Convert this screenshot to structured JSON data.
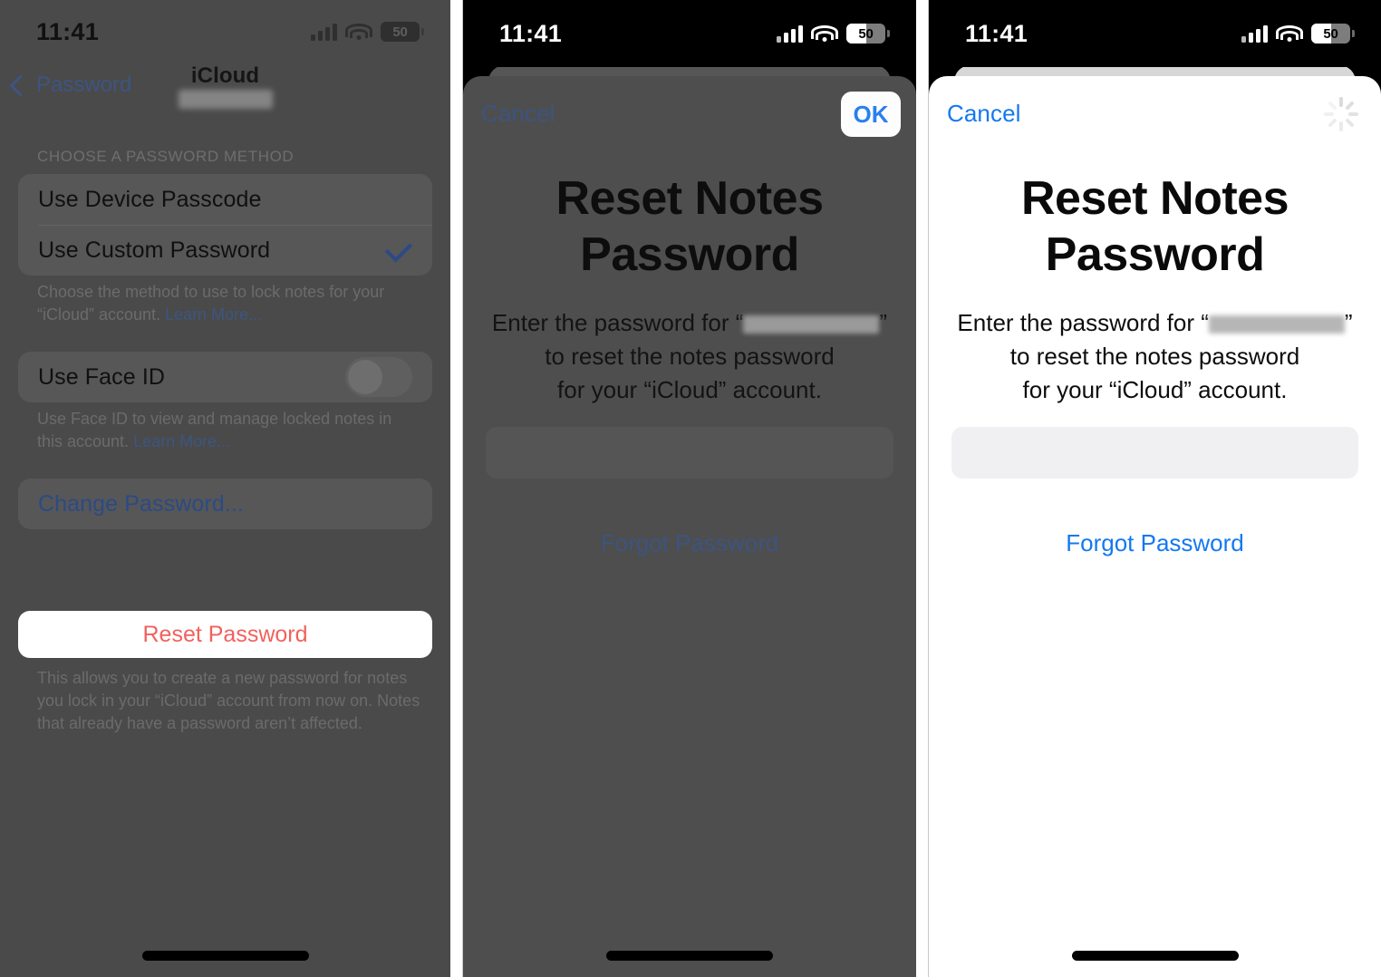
{
  "colors": {
    "ios_blue": "#1478f0",
    "destructive_red": "#f2615c",
    "dim_background": "#4a4a4a",
    "sheet_white": "#ffffff",
    "status_dark": "#000000"
  },
  "status_bar": {
    "time": "11:41",
    "battery_percent": "50",
    "icons": [
      "cellular-signal-icon",
      "wifi-icon",
      "battery-icon"
    ]
  },
  "panel_1": {
    "nav": {
      "back_label": "Password",
      "back_icon": "chevron-left-icon",
      "title": "iCloud",
      "subtitle_redacted": ""
    },
    "group_header": "CHOOSE A PASSWORD METHOD",
    "method_rows": [
      {
        "label": "Use Device Passcode",
        "selected": false
      },
      {
        "label": "Use Custom Password",
        "selected": true,
        "accessory": "checkmark-icon"
      }
    ],
    "method_footnote": "Choose the method to use to lock notes for your “iCloud” account.",
    "method_footnote_link": "Learn More...",
    "faceid_row": {
      "label": "Use Face ID",
      "toggle_state": "off"
    },
    "faceid_footnote": "Use Face ID to view and manage locked notes in this account.",
    "faceid_footnote_link": "Learn More...",
    "change_password_label": "Change Password...",
    "reset_button_label": "Reset Password",
    "reset_footnote": "This allows you to create a new password for notes you lock in your “iCloud” account from now on. Notes that already have a password aren’t affected."
  },
  "panel_2": {
    "cancel_label": "Cancel",
    "confirm_label": "OK",
    "title": "Reset Notes Password",
    "description_line1_prefix": "Enter the password for “",
    "description_line1_suffix": "”",
    "description_line2": "to reset the notes password",
    "description_line3": "for your “iCloud” account.",
    "password_field_value": "",
    "password_field_placeholder": "",
    "forgot_label": "Forgot Password"
  },
  "panel_3": {
    "cancel_label": "Cancel",
    "accessory_icon": "activity-spinner-icon",
    "title": "Reset Notes Password",
    "description_line1_prefix": "Enter the password for “",
    "description_line1_suffix": "”",
    "description_line2": "to reset the notes password",
    "description_line3": "for your “iCloud” account.",
    "password_field_value": "",
    "password_field_placeholder": "",
    "forgot_label": "Forgot Password"
  }
}
